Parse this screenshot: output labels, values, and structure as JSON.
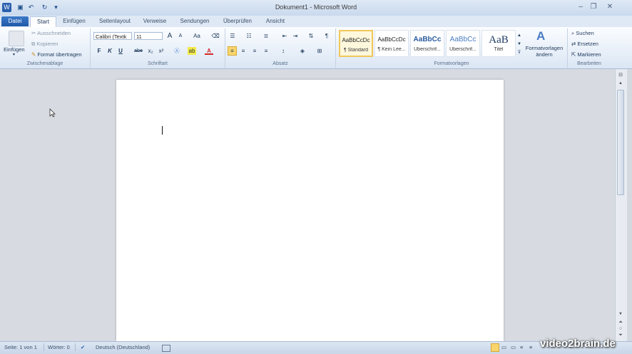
{
  "window": {
    "title": "Dokument1 - Microsoft Word"
  },
  "quick_access": {
    "icons": [
      "word-app-icon",
      "save-icon",
      "undo-icon",
      "redo-icon",
      "customize-icon"
    ]
  },
  "tabs": [
    "Datei",
    "Start",
    "Einfügen",
    "Seitenlayout",
    "Verweise",
    "Sendungen",
    "Überprüfen",
    "Ansicht"
  ],
  "clipboard": {
    "paste": "Einfügen",
    "cut": "Ausschneiden",
    "copy": "Kopieren",
    "format_painter": "Format übertragen",
    "label": "Zwischenablage"
  },
  "font": {
    "family": "Calibri (Textk",
    "size": "11",
    "grow": "A",
    "shrink": "A",
    "case": "Aa",
    "bold": "F",
    "italic": "K",
    "underline": "U",
    "strike": "abe",
    "subscript": "x₂",
    "superscript": "x²",
    "color": "A",
    "label": "Schriftart"
  },
  "paragraph": {
    "label": "Absatz",
    "pilcrow": "¶"
  },
  "styles": {
    "items": [
      {
        "preview": "AaBbCcDc",
        "name": "¶ Standard"
      },
      {
        "preview": "AaBbCcDc",
        "name": "¶ Kein Lee..."
      },
      {
        "preview": "AaBbCc",
        "name": "Überschrif..."
      },
      {
        "preview": "AaBbCc",
        "name": "Überschrif..."
      },
      {
        "preview": "AaB",
        "name": "Titel"
      }
    ],
    "change_styles": "Formatvorlagen ändern",
    "label": "Formatvorlagen"
  },
  "editing": {
    "find": "Suchen",
    "replace": "Ersetzen",
    "select": "Markieren",
    "label": "Bearbeiten"
  },
  "status": {
    "page": "Seite: 1 von 1",
    "words": "Wörter: 0",
    "language": "Deutsch (Deutschland)"
  },
  "watermark": "video2brain.de",
  "colors": {
    "accent": "#1e5aa8",
    "ribbon": "#dbe6f4",
    "page": "#ffffff"
  }
}
